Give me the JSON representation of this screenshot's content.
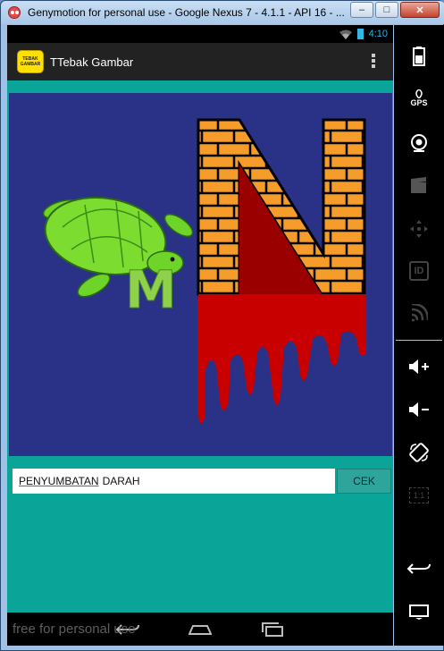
{
  "window": {
    "title": "Genymotion for personal use - Google Nexus 7 - 4.1.1 - API 16 - ...",
    "minimize": "–",
    "maximize": "□",
    "close": "✕"
  },
  "statusbar": {
    "time": "4:10"
  },
  "actionbar": {
    "logo_line1": "TEBAK",
    "logo_line2": "GAMBAR",
    "title": "TTebak Gambar"
  },
  "puzzle": {
    "letter_m": "M"
  },
  "answer": {
    "word1": "PENYUMBATAN",
    "word2": "DARAH",
    "button": "CEK"
  },
  "sidepanel": {
    "gps": "GPS",
    "id": "ID",
    "ratio": "1:1"
  },
  "watermark": "free for personal use",
  "colors": {
    "teal": "#0aa598",
    "puzzle_bg": "#2a3287",
    "brick": "#f59c2b",
    "blood": "#c80000"
  }
}
